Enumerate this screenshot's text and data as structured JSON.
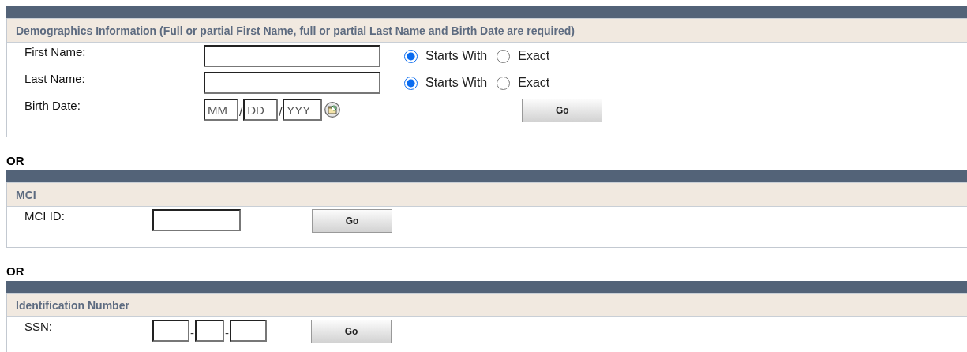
{
  "sections": [
    {
      "title": "Demographics Information (Full or partial First Name, full or partial Last Name and Birth Date are required)",
      "fields": [
        {
          "kind": "text",
          "label": "First Name:",
          "match": [
            {
              "label": "Starts With",
              "selected": true
            },
            {
              "label": "Exact",
              "selected": false
            }
          ]
        },
        {
          "kind": "text",
          "label": "Last Name:",
          "match": [
            {
              "label": "Starts With",
              "selected": true
            },
            {
              "label": "Exact",
              "selected": false
            }
          ]
        },
        {
          "kind": "date",
          "label": "Birth Date:",
          "segments": [
            {
              "kind": "input",
              "placeholder": "MM"
            },
            {
              "kind": "sep",
              "text": "/"
            },
            {
              "kind": "input",
              "placeholder": "DD"
            },
            {
              "kind": "sep",
              "text": "/"
            },
            {
              "kind": "input",
              "placeholder": "YYY"
            }
          ]
        }
      ],
      "button": "Go"
    },
    {
      "or": "OR",
      "title": "MCI",
      "fields": [
        {
          "kind": "text",
          "label": "MCI ID:"
        }
      ],
      "button": "Go"
    },
    {
      "or": "OR",
      "title": "Identification Number",
      "fields": [
        {
          "kind": "ssn",
          "label": "SSN:",
          "segments": [
            {
              "kind": "input"
            },
            {
              "kind": "sep",
              "text": "-"
            },
            {
              "kind": "input"
            },
            {
              "kind": "sep",
              "text": "-"
            },
            {
              "kind": "input"
            }
          ]
        }
      ],
      "button": "Go"
    }
  ]
}
